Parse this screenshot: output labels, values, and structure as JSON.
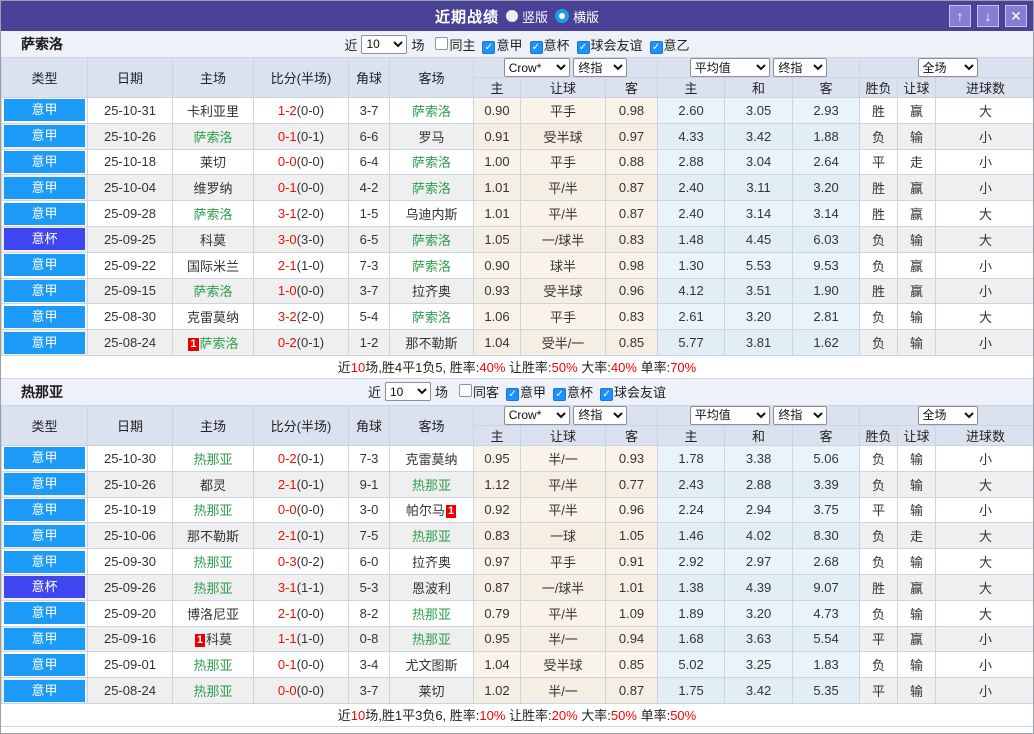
{
  "titlebar": {
    "title": "近期战绩",
    "radios": [
      {
        "label": "竖版",
        "selected": false
      },
      {
        "label": "横版",
        "selected": true
      }
    ],
    "buttons": {
      "up": "↑",
      "down": "↓",
      "close": "✕"
    }
  },
  "table_headers": {
    "type": "类型",
    "date": "日期",
    "home": "主场",
    "score": "比分(半场)",
    "corner": "角球",
    "away": "客场",
    "sub": [
      "主",
      "让球",
      "客",
      "主",
      "和",
      "客",
      "胜负",
      "让球",
      "进球数"
    ]
  },
  "type_colors": {
    "意甲": "#1b9af7",
    "意杯": "#3f46f0"
  },
  "result_colors": {
    "胜": "red",
    "负": "blue",
    "平": "green",
    "赢": "red",
    "输": "blue",
    "走": "green",
    "大": "red",
    "小": "blue"
  },
  "sections": [
    {
      "team": "萨索洛",
      "filter": {
        "prefix": "近",
        "count": "10",
        "suffix": "场",
        "checks": [
          {
            "label": "同主",
            "checked": false
          },
          {
            "label": "意甲",
            "checked": true
          },
          {
            "label": "意杯",
            "checked": true
          },
          {
            "label": "球会友谊",
            "checked": true
          },
          {
            "label": "意乙",
            "checked": true
          }
        ]
      },
      "dropdowns": [
        "Crow*",
        "终指",
        "平均值",
        "终指",
        "全场"
      ],
      "rows": [
        {
          "type": "意甲",
          "date": "25-10-31",
          "home": {
            "n": "卡利亚里"
          },
          "score": "1-2",
          "half": "(0-0)",
          "corner": "3-7",
          "away": {
            "n": "萨索洛",
            "g": true
          },
          "odds": [
            "0.90",
            "平手",
            "0.98"
          ],
          "avg": [
            "2.60",
            "3.05",
            "2.93"
          ],
          "res": [
            "胜",
            "赢",
            "大"
          ]
        },
        {
          "type": "意甲",
          "date": "25-10-26",
          "home": {
            "n": "萨索洛",
            "g": true
          },
          "score": "0-1",
          "half": "(0-1)",
          "corner": "6-6",
          "away": {
            "n": "罗马"
          },
          "odds": [
            "0.91",
            "受半球",
            "0.97"
          ],
          "avg": [
            "4.33",
            "3.42",
            "1.88"
          ],
          "res": [
            "负",
            "输",
            "小"
          ]
        },
        {
          "type": "意甲",
          "date": "25-10-18",
          "home": {
            "n": "莱切"
          },
          "score": "0-0",
          "half": "(0-0)",
          "corner": "6-4",
          "away": {
            "n": "萨索洛",
            "g": true
          },
          "odds": [
            "1.00",
            "平手",
            "0.88"
          ],
          "avg": [
            "2.88",
            "3.04",
            "2.64"
          ],
          "res": [
            "平",
            "走",
            "小"
          ]
        },
        {
          "type": "意甲",
          "date": "25-10-04",
          "home": {
            "n": "维罗纳"
          },
          "score": "0-1",
          "half": "(0-0)",
          "corner": "4-2",
          "away": {
            "n": "萨索洛",
            "g": true
          },
          "odds": [
            "1.01",
            "平/半",
            "0.87"
          ],
          "avg": [
            "2.40",
            "3.11",
            "3.20"
          ],
          "res": [
            "胜",
            "赢",
            "小"
          ]
        },
        {
          "type": "意甲",
          "date": "25-09-28",
          "home": {
            "n": "萨索洛",
            "g": true
          },
          "score": "3-1",
          "half": "(2-0)",
          "corner": "1-5",
          "away": {
            "n": "乌迪内斯"
          },
          "odds": [
            "1.01",
            "平/半",
            "0.87"
          ],
          "avg": [
            "2.40",
            "3.14",
            "3.14"
          ],
          "res": [
            "胜",
            "赢",
            "大"
          ]
        },
        {
          "type": "意杯",
          "date": "25-09-25",
          "home": {
            "n": "科莫"
          },
          "score": "3-0",
          "half": "(3-0)",
          "corner": "6-5",
          "away": {
            "n": "萨索洛",
            "g": true
          },
          "odds": [
            "1.05",
            "一/球半",
            "0.83"
          ],
          "avg": [
            "1.48",
            "4.45",
            "6.03"
          ],
          "res": [
            "负",
            "输",
            "大"
          ]
        },
        {
          "type": "意甲",
          "date": "25-09-22",
          "home": {
            "n": "国际米兰"
          },
          "score": "2-1",
          "half": "(1-0)",
          "corner": "7-3",
          "away": {
            "n": "萨索洛",
            "g": true
          },
          "odds": [
            "0.90",
            "球半",
            "0.98"
          ],
          "avg": [
            "1.30",
            "5.53",
            "9.53"
          ],
          "res": [
            "负",
            "赢",
            "小"
          ]
        },
        {
          "type": "意甲",
          "date": "25-09-15",
          "home": {
            "n": "萨索洛",
            "g": true
          },
          "score": "1-0",
          "half": "(0-0)",
          "corner": "3-7",
          "away": {
            "n": "拉齐奥"
          },
          "odds": [
            "0.93",
            "受半球",
            "0.96"
          ],
          "avg": [
            "4.12",
            "3.51",
            "1.90"
          ],
          "res": [
            "胜",
            "赢",
            "小"
          ]
        },
        {
          "type": "意甲",
          "date": "25-08-30",
          "home": {
            "n": "克雷莫纳"
          },
          "score": "3-2",
          "half": "(2-0)",
          "corner": "5-4",
          "away": {
            "n": "萨索洛",
            "g": true
          },
          "odds": [
            "1.06",
            "平手",
            "0.83"
          ],
          "avg": [
            "2.61",
            "3.20",
            "2.81"
          ],
          "res": [
            "负",
            "输",
            "大"
          ]
        },
        {
          "type": "意甲",
          "date": "25-08-24",
          "home": {
            "n": "萨索洛",
            "g": true,
            "card": "1",
            "cardpos": "before"
          },
          "score": "0-2",
          "half": "(0-1)",
          "corner": "1-2",
          "away": {
            "n": "那不勒斯"
          },
          "odds": [
            "1.04",
            "受半/一",
            "0.85"
          ],
          "avg": [
            "5.77",
            "3.81",
            "1.62"
          ],
          "res": [
            "负",
            "输",
            "小"
          ]
        }
      ],
      "summary": [
        {
          "t": "近"
        },
        {
          "t": "10",
          "red": true
        },
        {
          "t": "场,胜4平1负5, 胜率:"
        },
        {
          "t": "40%",
          "red": true
        },
        {
          "t": " 让胜率:"
        },
        {
          "t": "50%",
          "red": true
        },
        {
          "t": " 大率:"
        },
        {
          "t": "40%",
          "red": true
        },
        {
          "t": " 单率:"
        },
        {
          "t": "70%",
          "red": true
        }
      ]
    },
    {
      "team": "热那亚",
      "filter": {
        "prefix": "近",
        "count": "10",
        "suffix": "场",
        "checks": [
          {
            "label": "同客",
            "checked": false
          },
          {
            "label": "意甲",
            "checked": true
          },
          {
            "label": "意杯",
            "checked": true
          },
          {
            "label": "球会友谊",
            "checked": true
          }
        ]
      },
      "dropdowns": [
        "Crow*",
        "终指",
        "平均值",
        "终指",
        "全场"
      ],
      "rows": [
        {
          "type": "意甲",
          "date": "25-10-30",
          "home": {
            "n": "热那亚",
            "g": true
          },
          "score": "0-2",
          "half": "(0-1)",
          "corner": "7-3",
          "away": {
            "n": "克雷莫纳"
          },
          "odds": [
            "0.95",
            "半/一",
            "0.93"
          ],
          "avg": [
            "1.78",
            "3.38",
            "5.06"
          ],
          "res": [
            "负",
            "输",
            "小"
          ]
        },
        {
          "type": "意甲",
          "date": "25-10-26",
          "home": {
            "n": "都灵"
          },
          "score": "2-1",
          "half": "(0-1)",
          "corner": "9-1",
          "away": {
            "n": "热那亚",
            "g": true
          },
          "odds": [
            "1.12",
            "平/半",
            "0.77"
          ],
          "avg": [
            "2.43",
            "2.88",
            "3.39"
          ],
          "res": [
            "负",
            "输",
            "大"
          ]
        },
        {
          "type": "意甲",
          "date": "25-10-19",
          "home": {
            "n": "热那亚",
            "g": true
          },
          "score": "0-0",
          "half": "(0-0)",
          "corner": "3-0",
          "away": {
            "n": "帕尔马",
            "card": "1",
            "cardpos": "after"
          },
          "odds": [
            "0.92",
            "平/半",
            "0.96"
          ],
          "avg": [
            "2.24",
            "2.94",
            "3.75"
          ],
          "res": [
            "平",
            "输",
            "小"
          ]
        },
        {
          "type": "意甲",
          "date": "25-10-06",
          "home": {
            "n": "那不勒斯"
          },
          "score": "2-1",
          "half": "(0-1)",
          "corner": "7-5",
          "away": {
            "n": "热那亚",
            "g": true
          },
          "odds": [
            "0.83",
            "一球",
            "1.05"
          ],
          "avg": [
            "1.46",
            "4.02",
            "8.30"
          ],
          "res": [
            "负",
            "走",
            "大"
          ]
        },
        {
          "type": "意甲",
          "date": "25-09-30",
          "home": {
            "n": "热那亚",
            "g": true
          },
          "score": "0-3",
          "half": "(0-2)",
          "corner": "6-0",
          "away": {
            "n": "拉齐奥"
          },
          "odds": [
            "0.97",
            "平手",
            "0.91"
          ],
          "avg": [
            "2.92",
            "2.97",
            "2.68"
          ],
          "res": [
            "负",
            "输",
            "大"
          ]
        },
        {
          "type": "意杯",
          "date": "25-09-26",
          "home": {
            "n": "热那亚",
            "g": true
          },
          "score": "3-1",
          "half": "(1-1)",
          "corner": "5-3",
          "away": {
            "n": "恩波利"
          },
          "odds": [
            "0.87",
            "一/球半",
            "1.01"
          ],
          "avg": [
            "1.38",
            "4.39",
            "9.07"
          ],
          "res": [
            "胜",
            "赢",
            "大"
          ]
        },
        {
          "type": "意甲",
          "date": "25-09-20",
          "home": {
            "n": "博洛尼亚"
          },
          "score": "2-1",
          "half": "(0-0)",
          "corner": "8-2",
          "away": {
            "n": "热那亚",
            "g": true
          },
          "odds": [
            "0.79",
            "平/半",
            "1.09"
          ],
          "avg": [
            "1.89",
            "3.20",
            "4.73"
          ],
          "res": [
            "负",
            "输",
            "大"
          ]
        },
        {
          "type": "意甲",
          "date": "25-09-16",
          "home": {
            "n": "科莫",
            "card": "1",
            "cardpos": "before"
          },
          "score": "1-1",
          "half": "(1-0)",
          "corner": "0-8",
          "away": {
            "n": "热那亚",
            "g": true
          },
          "odds": [
            "0.95",
            "半/一",
            "0.94"
          ],
          "avg": [
            "1.68",
            "3.63",
            "5.54"
          ],
          "res": [
            "平",
            "赢",
            "小"
          ]
        },
        {
          "type": "意甲",
          "date": "25-09-01",
          "home": {
            "n": "热那亚",
            "g": true
          },
          "score": "0-1",
          "half": "(0-0)",
          "corner": "3-4",
          "away": {
            "n": "尤文图斯"
          },
          "odds": [
            "1.04",
            "受半球",
            "0.85"
          ],
          "avg": [
            "5.02",
            "3.25",
            "1.83"
          ],
          "res": [
            "负",
            "输",
            "小"
          ]
        },
        {
          "type": "意甲",
          "date": "25-08-24",
          "home": {
            "n": "热那亚",
            "g": true
          },
          "score": "0-0",
          "half": "(0-0)",
          "corner": "3-7",
          "away": {
            "n": "莱切"
          },
          "odds": [
            "1.02",
            "半/一",
            "0.87"
          ],
          "avg": [
            "1.75",
            "3.42",
            "5.35"
          ],
          "res": [
            "平",
            "输",
            "小"
          ]
        }
      ],
      "summary": [
        {
          "t": "近"
        },
        {
          "t": "10",
          "red": true
        },
        {
          "t": "场,胜1平3负6, 胜率:"
        },
        {
          "t": "10%",
          "red": true
        },
        {
          "t": " 让胜率:"
        },
        {
          "t": "20%",
          "red": true
        },
        {
          "t": " 大率:"
        },
        {
          "t": "50%",
          "red": true
        },
        {
          "t": " 单率:"
        },
        {
          "t": "50%",
          "red": true
        }
      ]
    }
  ]
}
